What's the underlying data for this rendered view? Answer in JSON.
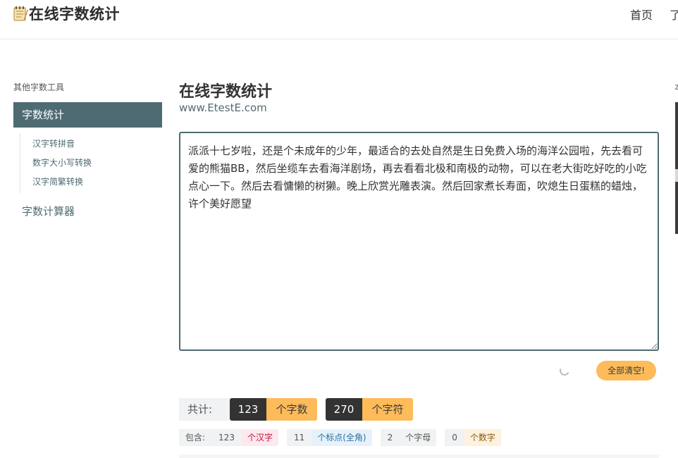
{
  "header": {
    "logo_icon": "notepad-icon",
    "site_title": "在线字数统计",
    "nav": {
      "home": "首页",
      "clipped": "了"
    }
  },
  "sidebar": {
    "caption": "其他字数工具",
    "active_item": "字数统计",
    "sub_items": [
      {
        "label": "汉字转拼音"
      },
      {
        "label": "数字大小写转换"
      },
      {
        "label": "汉字简繁转换"
      }
    ],
    "other_item": "字数计算器"
  },
  "main": {
    "title": "在线字数统计",
    "url": "www.EtestE.com",
    "input_text": "派派十七岁啦，还是个未成年的少年，最适合的去处自然是生日免费入场的海洋公园啦，先去看可爱的熊猫BB，然后坐缆车去看海洋剧场，再去看看北极和南极的动物，可以在老大街吃好吃的小吃点心一下。然后去看慵懒的树獭。晚上欣赏光雕表演。然后回家煮长寿面，吹熄生日蛋糕的蜡烛，许个美好愿望",
    "clear_button": "全部清空!",
    "summary": {
      "label": "共计:",
      "char_count": "123",
      "char_unit": "个字数",
      "symbol_count": "270",
      "symbol_unit": "个字符"
    },
    "detail": {
      "label": "包含:",
      "items": [
        {
          "count": "123",
          "unit": "个汉字",
          "color": "#c0103c"
        },
        {
          "count": "11",
          "unit": "个标点(全角)",
          "color": "#2a6f9e"
        },
        {
          "count": "2",
          "unit": "个字母",
          "color": "#555555"
        },
        {
          "count": "0",
          "unit": "个数字",
          "color": "#8a5a10"
        }
      ]
    }
  },
  "right_edge": {
    "glyph": "本"
  },
  "colors": {
    "accent": "#4e6b72",
    "button": "#fdbb5a",
    "dark_badge": "#333333"
  }
}
